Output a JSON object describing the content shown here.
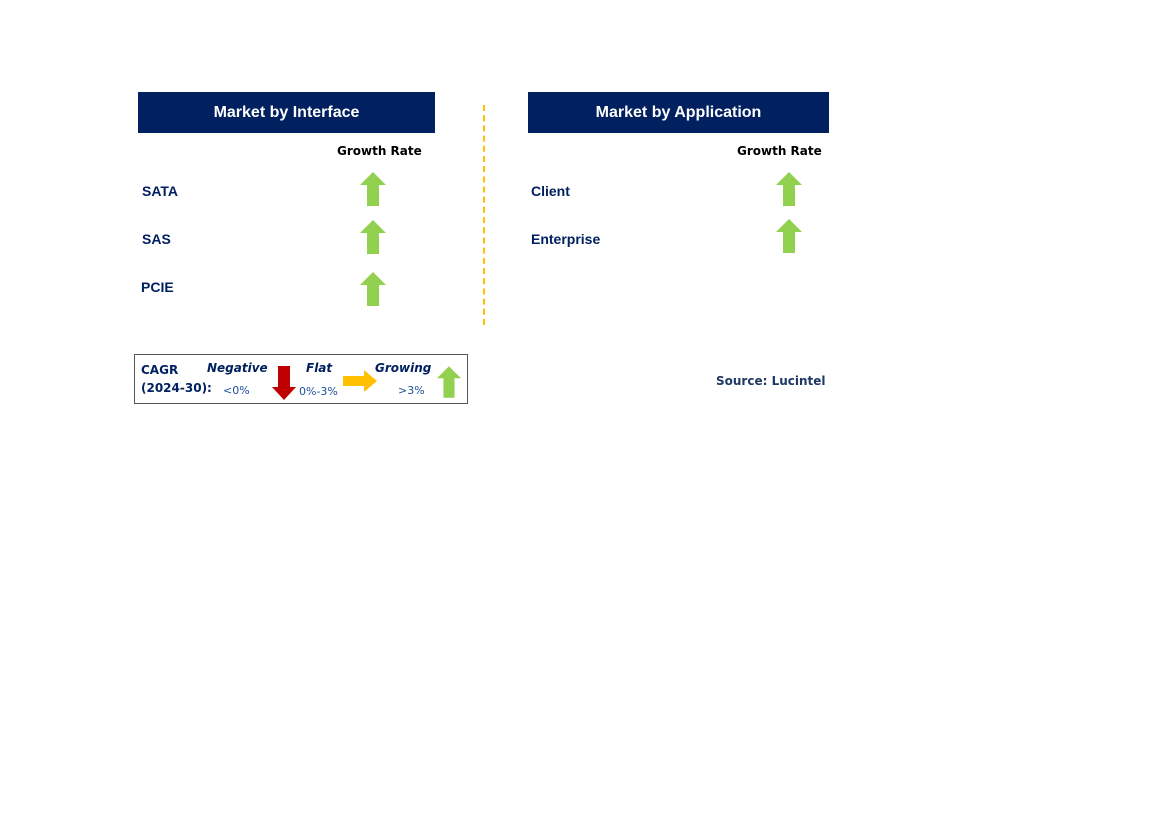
{
  "colors": {
    "header_bg": "#002060",
    "label": "#002060",
    "growing": "#92D050",
    "negative": "#C00000",
    "flat": "#FFC000",
    "divider": "#FFC000"
  },
  "left_panel": {
    "title": "Market by Interface",
    "column_header": "Growth Rate",
    "rows": [
      {
        "label": "SATA",
        "trend": "growing",
        "icon": "up-arrow-icon"
      },
      {
        "label": "SAS",
        "trend": "growing",
        "icon": "up-arrow-icon"
      },
      {
        "label": "PCIE",
        "trend": "growing",
        "icon": "up-arrow-icon"
      }
    ]
  },
  "right_panel": {
    "title": "Market by Application",
    "column_header": "Growth Rate",
    "rows": [
      {
        "label": "Client",
        "trend": "growing",
        "icon": "up-arrow-icon"
      },
      {
        "label": "Enterprise",
        "trend": "growing",
        "icon": "up-arrow-icon"
      }
    ]
  },
  "legend": {
    "title_line1": "CAGR",
    "title_line2": "(2024-30):",
    "items": [
      {
        "label": "Negative",
        "range": "<0%",
        "icon": "down-arrow-icon"
      },
      {
        "label": "Flat",
        "range": "0%-3%",
        "icon": "right-arrow-icon"
      },
      {
        "label": "Growing",
        "range": ">3%",
        "icon": "up-arrow-icon"
      }
    ]
  },
  "source": "Source: Lucintel"
}
